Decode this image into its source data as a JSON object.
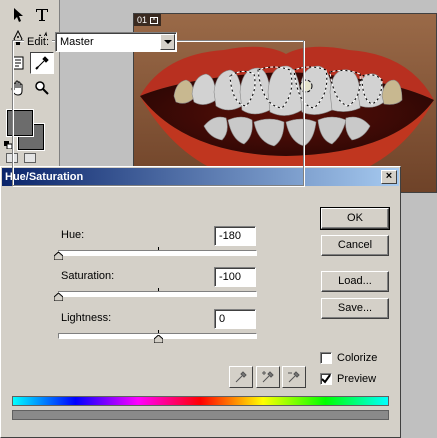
{
  "document": {
    "tab_label": "01"
  },
  "dialog": {
    "title": "Hue/Saturation",
    "edit": {
      "label": "Edit:",
      "value": "Master"
    },
    "hue": {
      "label": "Hue:",
      "value": "-180"
    },
    "saturation": {
      "label": "Saturation:",
      "value": "-100"
    },
    "lightness": {
      "label": "Lightness:",
      "value": "0"
    },
    "buttons": {
      "ok": "OK",
      "cancel": "Cancel",
      "load": "Load...",
      "save": "Save..."
    },
    "colorize": {
      "label": "Colorize",
      "checked": false
    },
    "preview": {
      "label": "Preview",
      "checked": true
    }
  },
  "colors": {
    "title_start": "#0a246a",
    "title_end": "#a6caf0",
    "dialog_bg": "#d4d0c8",
    "lips": "#b83020",
    "teeth": "#cfcfcf"
  }
}
